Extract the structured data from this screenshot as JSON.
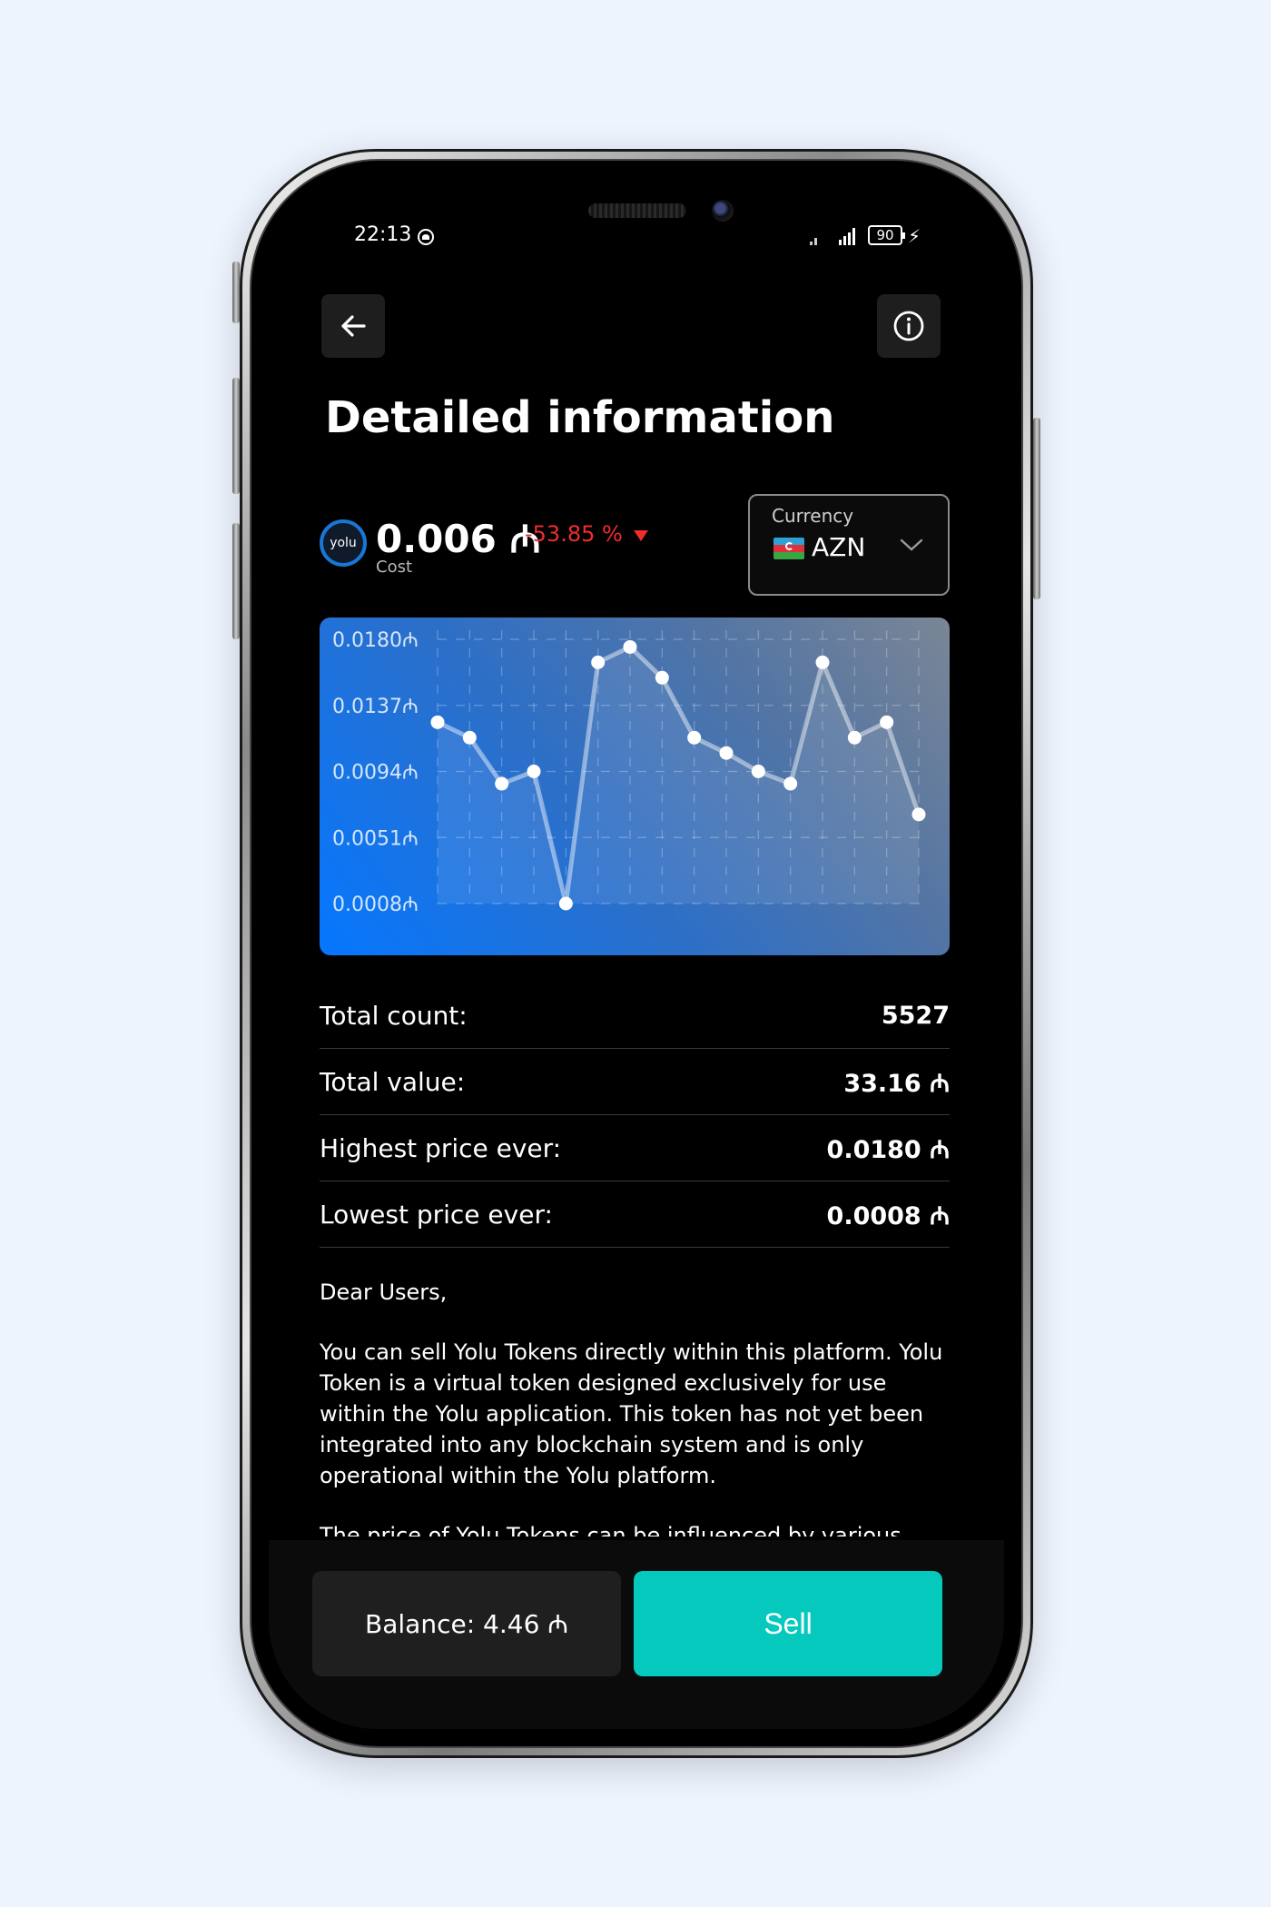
{
  "status_bar": {
    "time": "22:13",
    "battery": "90"
  },
  "header": {
    "title": "Detailed information"
  },
  "token": {
    "logo_text": "yolu",
    "price": "0.006 ₼",
    "change": "-53.85 %",
    "cost_label": "Cost"
  },
  "currency": {
    "caption": "Currency",
    "value": "AZN"
  },
  "chart_data": {
    "type": "line",
    "y_tick_labels": [
      "0.0180₼",
      "0.0137₼",
      "0.0094₼",
      "0.0051₼",
      "0.0008₼"
    ],
    "ylim": [
      0.0008,
      0.018
    ],
    "values": [
      0.0126,
      0.0116,
      0.0086,
      0.0094,
      0.0008,
      0.0165,
      0.0175,
      0.0155,
      0.0116,
      0.0106,
      0.0094,
      0.0086,
      0.0165,
      0.0116,
      0.0126,
      0.0066
    ],
    "grid": true
  },
  "stats": [
    {
      "label": "Total count:",
      "value": "5527"
    },
    {
      "label": "Total value:",
      "value": "33.16 ₼"
    },
    {
      "label": "Highest price ever:",
      "value": "0.0180 ₼"
    },
    {
      "label": "Lowest price ever:",
      "value": "0.0008 ₼"
    }
  ],
  "notice": {
    "greeting": "Dear Users,",
    "body": "You can sell Yolu Tokens directly within this platform. Yolu Token is a virtual token designed exclusively for use within the Yolu application. This token has not yet been integrated into any blockchain system and is only operational within the Yolu platform.",
    "continuation": "The price of Yolu Tokens can be influenced by various"
  },
  "actions": {
    "balance": "Balance: 4.46 ₼",
    "sell": "Sell"
  },
  "colors": {
    "accent": "#06c9bd",
    "negative": "#ee2d2d",
    "chart_start": "#0577ff"
  }
}
